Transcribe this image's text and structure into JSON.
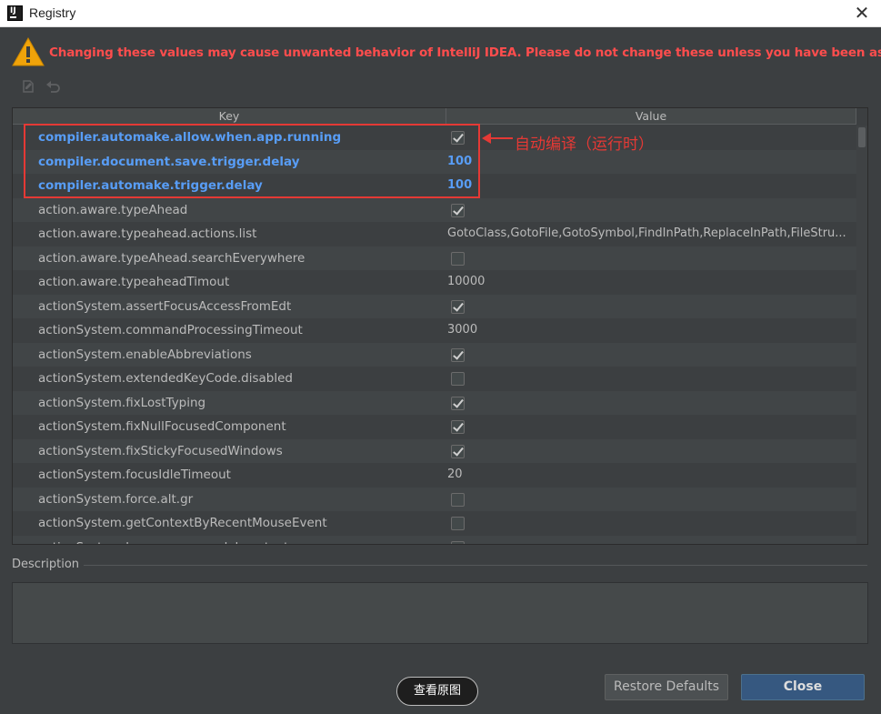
{
  "window": {
    "title": "Registry",
    "close_glyph": "✕",
    "app_icon_text": "IJ"
  },
  "warning": {
    "icon": "warning-triangle-icon",
    "text": "Changing these values may cause unwanted behavior of IntelliJ IDEA. Please do not change these unless you have been asked.",
    "color": "#ff4d4d"
  },
  "toolbar": {
    "icons": [
      "edit-icon",
      "undo-icon"
    ]
  },
  "table": {
    "headers": {
      "key": "Key",
      "value": "Value"
    },
    "rows": [
      {
        "key": "compiler.automake.allow.when.app.running",
        "type": "checkbox",
        "checked": true,
        "changed": true
      },
      {
        "key": "compiler.document.save.trigger.delay",
        "type": "text",
        "value": "100",
        "changed": true
      },
      {
        "key": "compiler.automake.trigger.delay",
        "type": "text",
        "value": "100",
        "changed": true
      },
      {
        "key": "action.aware.typeAhead",
        "type": "checkbox",
        "checked": true
      },
      {
        "key": "action.aware.typeahead.actions.list",
        "type": "text",
        "value": "GotoClass,GotoFile,GotoSymbol,FindInPath,ReplaceInPath,FileStru..."
      },
      {
        "key": "action.aware.typeAhead.searchEverywhere",
        "type": "checkbox",
        "checked": false
      },
      {
        "key": "action.aware.typeaheadTimout",
        "type": "text",
        "value": "10000"
      },
      {
        "key": "actionSystem.assertFocusAccessFromEdt",
        "type": "checkbox",
        "checked": true
      },
      {
        "key": "actionSystem.commandProcessingTimeout",
        "type": "text",
        "value": "3000"
      },
      {
        "key": "actionSystem.enableAbbreviations",
        "type": "checkbox",
        "checked": true
      },
      {
        "key": "actionSystem.extendedKeyCode.disabled",
        "type": "checkbox",
        "checked": false
      },
      {
        "key": "actionSystem.fixLostTyping",
        "type": "checkbox",
        "checked": true
      },
      {
        "key": "actionSystem.fixNullFocusedComponent",
        "type": "checkbox",
        "checked": true
      },
      {
        "key": "actionSystem.fixStickyFocusedWindows",
        "type": "checkbox",
        "checked": true
      },
      {
        "key": "actionSystem.focusIdleTimeout",
        "type": "text",
        "value": "20"
      },
      {
        "key": "actionSystem.force.alt.gr",
        "type": "checkbox",
        "checked": false
      },
      {
        "key": "actionSystem.getContextByRecentMouseEvent",
        "type": "checkbox",
        "checked": false
      },
      {
        "key": "actionSystem.keepmouse.modal.context",
        "type": "checkbox",
        "checked": false
      }
    ]
  },
  "annotation": {
    "text": "自动编译（运行时）",
    "color": "#e53935"
  },
  "description": {
    "label": "Description",
    "content": ""
  },
  "overlay": {
    "view_original": "查看原图"
  },
  "buttons": {
    "restore_defaults": "Restore Defaults",
    "close": "Close"
  },
  "colors": {
    "changed_key": "#589df6",
    "background": "#3c3f41",
    "accent": "#365880"
  }
}
